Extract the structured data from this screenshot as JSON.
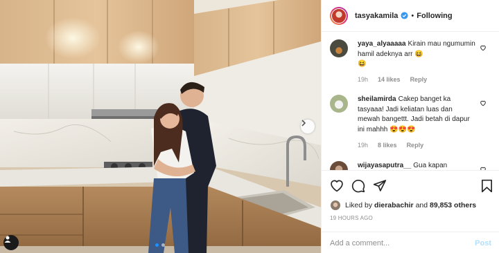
{
  "post": {
    "carousel": {
      "total_slides": 2,
      "active_slide": 1
    }
  },
  "header": {
    "username": "tasyakamila",
    "separator": "•",
    "follow_status": "Following",
    "verified_icon": "verified-badge-icon"
  },
  "comments": [
    {
      "username": "yaya_alyaaaaa",
      "text": "Kirain mau ngumumin hamil adeknya arr",
      "emojis": [
        "grinning-squinting-face",
        "grinning-squinting-face"
      ],
      "age": "19h",
      "likes": "14 likes",
      "reply_label": "Reply"
    },
    {
      "username": "sheilamirda",
      "text": "Cakep banget ka tasyaaa! Jadi keliatan luas dan mewah bangettt. Jadi betah di dapur ini mahhh",
      "emojis": [
        "smiling-face-with-heart-eyes",
        "smiling-face-with-heart-eyes",
        "smiling-face-with-heart-eyes"
      ],
      "age": "19h",
      "likes": "8 likes",
      "reply_label": "Reply"
    },
    {
      "username": "wijayasaputra__",
      "text": "Gua kapan",
      "emojis": [],
      "age": "",
      "likes": "",
      "reply_label": ""
    }
  ],
  "actions": {
    "icons": [
      "heart-icon",
      "comment-icon",
      "share-icon",
      "bookmark-icon"
    ]
  },
  "likes": {
    "prefix": "Liked by",
    "user": "dierabachir",
    "connector": "and",
    "others": "89,853 others"
  },
  "timestamp": "19 HOURS AGO",
  "comment_box": {
    "placeholder": "Add a comment...",
    "post_label": "Post"
  },
  "colors": {
    "verified_blue": "#3897f0",
    "carousel_active": "#1e90ff",
    "post_disabled": "#b2dffc",
    "muted_text": "#8e8e8e"
  }
}
